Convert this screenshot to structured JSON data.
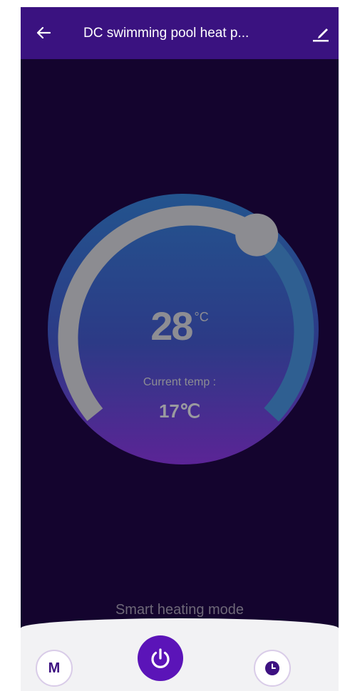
{
  "header": {
    "title": "DC swimming pool heat p...",
    "back_icon": "back-arrow-icon",
    "edit_icon": "edit-icon"
  },
  "thermostat": {
    "set_temp": "28",
    "set_unit": "°C",
    "current_label": "Current temp :",
    "current_value": "17℃"
  },
  "mode": {
    "label": "Smart heating mode"
  },
  "controls": {
    "mode_button": "M",
    "power_icon": "power-icon",
    "timer_icon": "clock-icon"
  },
  "colors": {
    "header_bg": "#3a1280",
    "background": "#14042e",
    "accent": "#5b14b8"
  }
}
